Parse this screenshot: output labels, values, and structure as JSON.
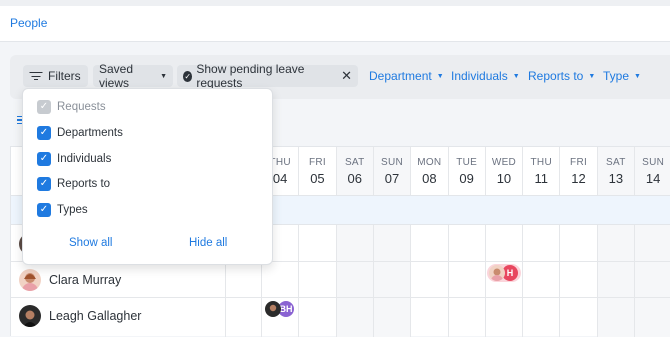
{
  "header": {
    "breadcrumb": "People"
  },
  "toolbar": {
    "filters_label": "Filters",
    "saved_views_label": "Saved views",
    "pending_label": "Show pending leave requests",
    "department_label": "Department",
    "individuals_label": "Individuals",
    "reports_to_label": "Reports to",
    "type_label": "Type"
  },
  "filter_panel": {
    "options": [
      {
        "label": "Requests",
        "checked": true,
        "disabled": true
      },
      {
        "label": "Departments",
        "checked": true,
        "disabled": false
      },
      {
        "label": "Individuals",
        "checked": true,
        "disabled": false
      },
      {
        "label": "Reports to",
        "checked": true,
        "disabled": false
      },
      {
        "label": "Types",
        "checked": true,
        "disabled": false
      }
    ],
    "show_all": "Show all",
    "hide_all": "Hide all"
  },
  "calendar": {
    "days": [
      {
        "name": "THU",
        "num": "04",
        "weekend": false
      },
      {
        "name": "FRI",
        "num": "05",
        "weekend": false
      },
      {
        "name": "SAT",
        "num": "06",
        "weekend": true
      },
      {
        "name": "SUN",
        "num": "07",
        "weekend": true
      },
      {
        "name": "MON",
        "num": "08",
        "weekend": false
      },
      {
        "name": "TUE",
        "num": "09",
        "weekend": false
      },
      {
        "name": "WED",
        "num": "10",
        "weekend": false
      },
      {
        "name": "THU",
        "num": "11",
        "weekend": false
      },
      {
        "name": "FRI",
        "num": "12",
        "weekend": false
      },
      {
        "name": "SAT",
        "num": "13",
        "weekend": true
      },
      {
        "name": "SUN",
        "num": "14",
        "weekend": true
      }
    ],
    "people": [
      {
        "name": "Clara Murray"
      },
      {
        "name": "Leagh Gallagher"
      }
    ],
    "badges": [
      {
        "initial": "H",
        "color": "#e8475f"
      },
      {
        "initial": "BH",
        "color": "#8a63d2"
      }
    ]
  },
  "colors": {
    "accent": "#1f7ae0",
    "weekend": "#f6f7f9",
    "group_row": "#eef5fd"
  }
}
